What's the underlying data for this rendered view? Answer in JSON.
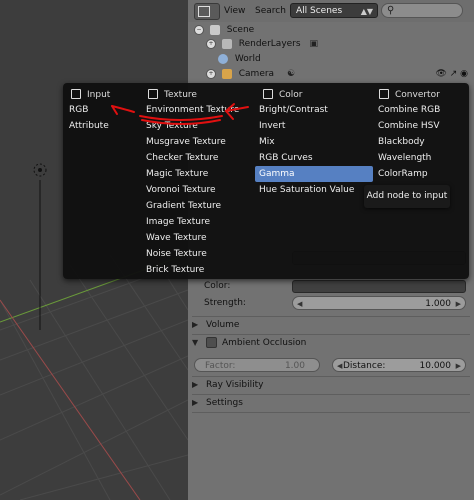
{
  "outliner_header": {
    "view_label": "View",
    "search_label": "Search",
    "scenes_value": "All Scenes",
    "search_icon": "search-icon"
  },
  "outliner": {
    "rows": [
      {
        "label": "Scene"
      },
      {
        "label": "RenderLayers"
      },
      {
        "label": "World"
      },
      {
        "label": "Camera"
      }
    ]
  },
  "properties": {
    "color_label": "Color:",
    "strength_label": "Strength:",
    "strength_value": "1.000",
    "volume_label": "Volume",
    "ambient_occlusion_label": "Ambient Occlusion",
    "factor_label": "Factor:",
    "factor_value": "1.00",
    "distance_label": "Distance:",
    "distance_value": "10.000",
    "ray_visibility_label": "Ray Visibility",
    "settings_label": "Settings"
  },
  "node_menu": {
    "columns": [
      {
        "title": "Input",
        "items": [
          "RGB",
          "Attribute"
        ]
      },
      {
        "title": "Texture",
        "items": [
          "Environment Texture",
          "Sky Texture",
          "Musgrave Texture",
          "Checker Texture",
          "Magic Texture",
          "Voronoi Texture",
          "Gradient Texture",
          "Image Texture",
          "Wave Texture",
          "Noise Texture",
          "Brick Texture"
        ]
      },
      {
        "title": "Color",
        "items": [
          "Bright/Contrast",
          "Invert",
          "Mix",
          "RGB Curves",
          "Gamma",
          "Hue Saturation Value"
        ],
        "active_item": "Gamma"
      },
      {
        "title": "Convertor",
        "items": [
          "Combine RGB",
          "Combine HSV",
          "Blackbody",
          "Wavelength",
          "ColorRamp"
        ]
      }
    ],
    "tooltip": "Add node to input"
  },
  "colors": {
    "menu_bg": "#101010",
    "highlight": "#5680c2",
    "annotation_red": "#e01010",
    "panel_bg": "#727272"
  }
}
